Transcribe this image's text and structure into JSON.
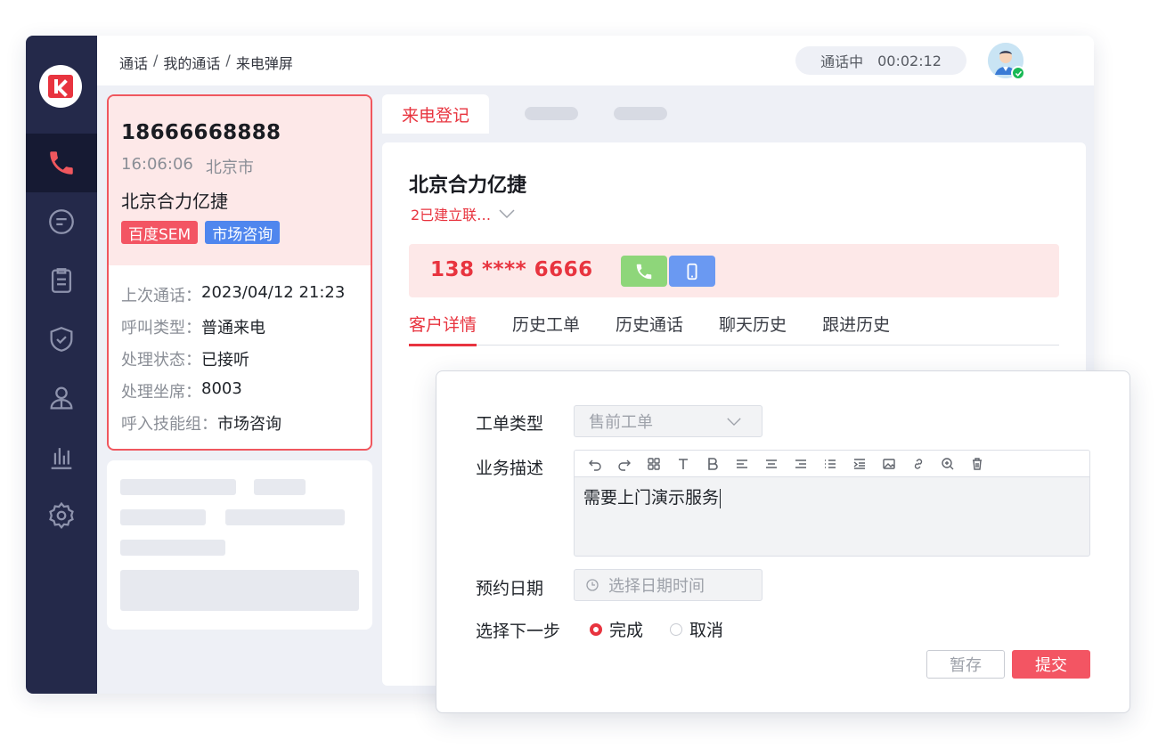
{
  "breadcrumb": [
    "通话",
    "我的通话",
    "来电弹屏"
  ],
  "header": {
    "status": "通话中",
    "timer": "00:02:12"
  },
  "call": {
    "number": "18666668888",
    "time": "16:06:06",
    "city": "北京市",
    "company": "北京合力亿捷",
    "tags": [
      {
        "label": "百度SEM",
        "color": "#f35563"
      },
      {
        "label": "市场咨询",
        "color": "#4f86ee"
      }
    ],
    "details": [
      {
        "key": "上次通话：",
        "value": "2023/04/12 21:23"
      },
      {
        "key": "呼叫类型：",
        "value": "普通来电"
      },
      {
        "key": "处理状态：",
        "value": "已接听"
      },
      {
        "key": "处理坐席：",
        "value": "8003"
      },
      {
        "key": "呼入技能组：",
        "value": "市场咨询"
      }
    ]
  },
  "top_tab": "来电登记",
  "customer": {
    "name": "北京合力亿捷",
    "status": "2已建立联…",
    "masked_phone": "138 **** 6666"
  },
  "sub_tabs": [
    "客户详情",
    "历史工单",
    "历史通话",
    "聊天历史",
    "跟进历史"
  ],
  "form": {
    "type_label": "工单类型",
    "type_value": "售前工单",
    "desc_label": "业务描述",
    "desc_value": "需要上门演示服务",
    "date_label": "预约日期",
    "date_placeholder": "选择日期时间",
    "next_label": "选择下一步",
    "options": [
      "完成",
      "取消"
    ],
    "selected": "完成",
    "save": "暂存",
    "submit": "提交"
  },
  "colors": {
    "accent": "#e8343f",
    "sidebar": "#24294a",
    "tag_blue": "#4f86ee"
  }
}
